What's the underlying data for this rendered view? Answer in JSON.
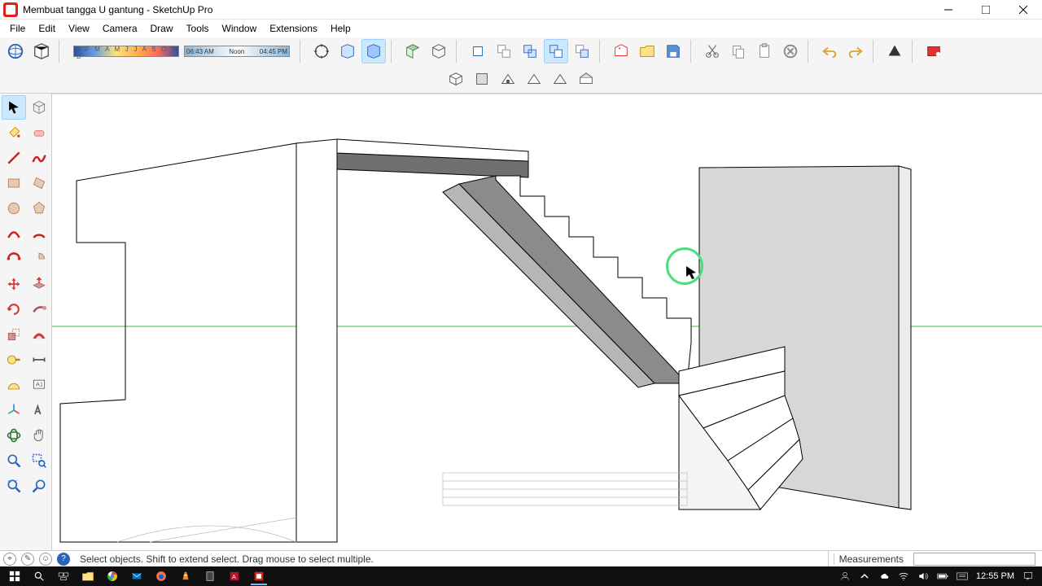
{
  "window": {
    "title": "Membuat tangga U gantung - SketchUp Pro"
  },
  "menu": {
    "items": [
      "File",
      "Edit",
      "View",
      "Camera",
      "Draw",
      "Tools",
      "Window",
      "Extensions",
      "Help"
    ]
  },
  "shadows": {
    "months": "J F M A M J J A S O N D",
    "time_start": "06:43 AM",
    "time_mid": "Noon",
    "time_end": "04:45 PM"
  },
  "status": {
    "hint": "Select objects. Shift to extend select. Drag mouse to select multiple.",
    "measurements_label": "Measurements",
    "measurements_value": ""
  },
  "taskbar": {
    "clock": "12:55 PM"
  }
}
